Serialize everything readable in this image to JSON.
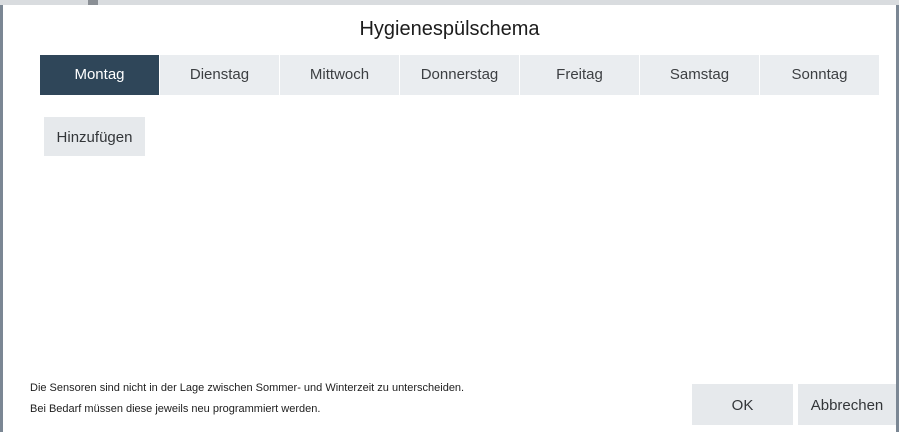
{
  "dialog": {
    "title": "Hygienespülschema"
  },
  "tabs": [
    {
      "label": "Montag",
      "active": true
    },
    {
      "label": "Dienstag",
      "active": false
    },
    {
      "label": "Mittwoch",
      "active": false
    },
    {
      "label": "Donnerstag",
      "active": false
    },
    {
      "label": "Freitag",
      "active": false
    },
    {
      "label": "Samstag",
      "active": false
    },
    {
      "label": "Sonntag",
      "active": false
    }
  ],
  "actions": {
    "add_label": "Hinzufügen",
    "ok_label": "OK",
    "cancel_label": "Abbrechen"
  },
  "note": {
    "line1": "Die Sensoren sind nicht in der Lage zwischen Sommer- und Winterzeit zu unterscheiden.",
    "line2": "Bei Bedarf müssen diese jeweils neu programmiert werden."
  },
  "colors": {
    "active_tab": "#2f4659",
    "inactive_tab": "#eaedf0",
    "button": "#e6e9ec"
  }
}
